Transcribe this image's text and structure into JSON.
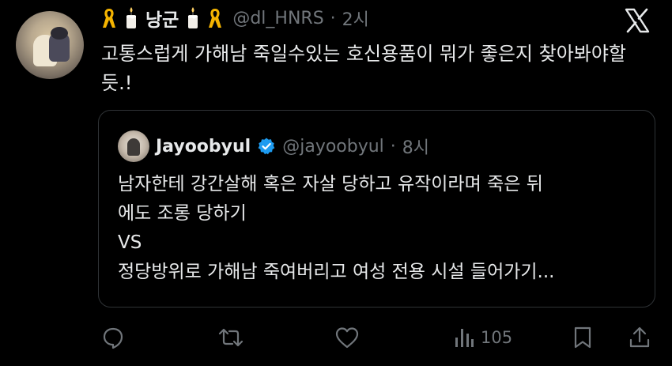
{
  "author": {
    "display_name": "낭군",
    "handle": "@dl_HNRS",
    "time": "2시"
  },
  "tweet": {
    "text": "고통스럽게 가해남 죽일수있는 호신용품이 뭐가 좋은지 찾아봐야할듯.!"
  },
  "quote": {
    "display_name": "Jayoobyul",
    "handle": "@jayoobyul",
    "time": "8시",
    "line1": "남자한테 강간살해 혹은 자살 당하고 유작이라며 죽은 뒤",
    "line2": "에도 조롱 당하기",
    "line3": "VS",
    "line4": "정당방위로 가해남 죽여버리고 여성 전용 시설 들어가기..."
  },
  "actions": {
    "views": "105",
    "icons": [
      "reply-icon",
      "retweet-icon",
      "like-icon",
      "views-icon",
      "bookmark-icon",
      "share-icon"
    ]
  },
  "colors": {
    "background": "#000000",
    "text": "#e7e9ea",
    "muted": "#71767b",
    "verified": "#1d9bf0",
    "ribbon": "#f5b400",
    "border": "#2f3336"
  }
}
